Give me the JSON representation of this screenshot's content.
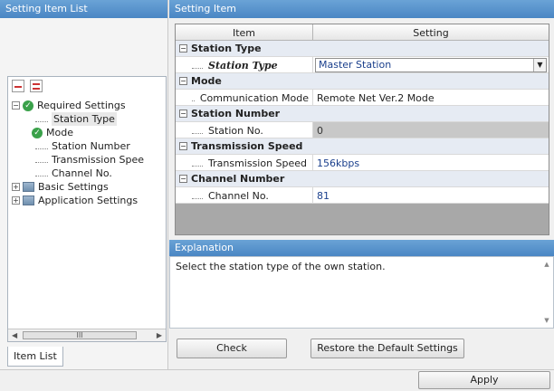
{
  "left": {
    "header": "Setting Item List",
    "tab_label": "Item List",
    "tree": {
      "required": "Required Settings",
      "required_children": [
        "Station Type",
        "Mode",
        "Station Number",
        "Transmission Spee",
        "Channel No."
      ],
      "basic": "Basic Settings",
      "application": "Application Settings"
    },
    "scroll_thumb": "III"
  },
  "right": {
    "header": "Setting Item",
    "grid_headers": {
      "item": "Item",
      "setting": "Setting"
    },
    "rows": {
      "station_type_cat": "Station Type",
      "station_type_item": "Station Type",
      "station_type_value": "Master Station",
      "mode_cat": "Mode",
      "mode_item": "Communication Mode",
      "mode_value": "Remote Net Ver.2 Mode",
      "station_number_cat": "Station Number",
      "station_no_item": "Station No.",
      "station_no_value": "0",
      "trans_speed_cat": "Transmission Speed",
      "trans_speed_item": "Transmission Speed",
      "trans_speed_value": "156kbps",
      "channel_cat": "Channel Number",
      "channel_item": "Channel No.",
      "channel_value": "81"
    },
    "explanation_header": "Explanation",
    "explanation_text": "Select the station type of the own station.",
    "check_button": "Check",
    "restore_button": "Restore the Default Settings"
  },
  "apply_button": "Apply",
  "colors": {
    "header_blue": "#4a86c4",
    "category_bg": "#e6ebf3",
    "value_blue": "#1a3f8c"
  }
}
